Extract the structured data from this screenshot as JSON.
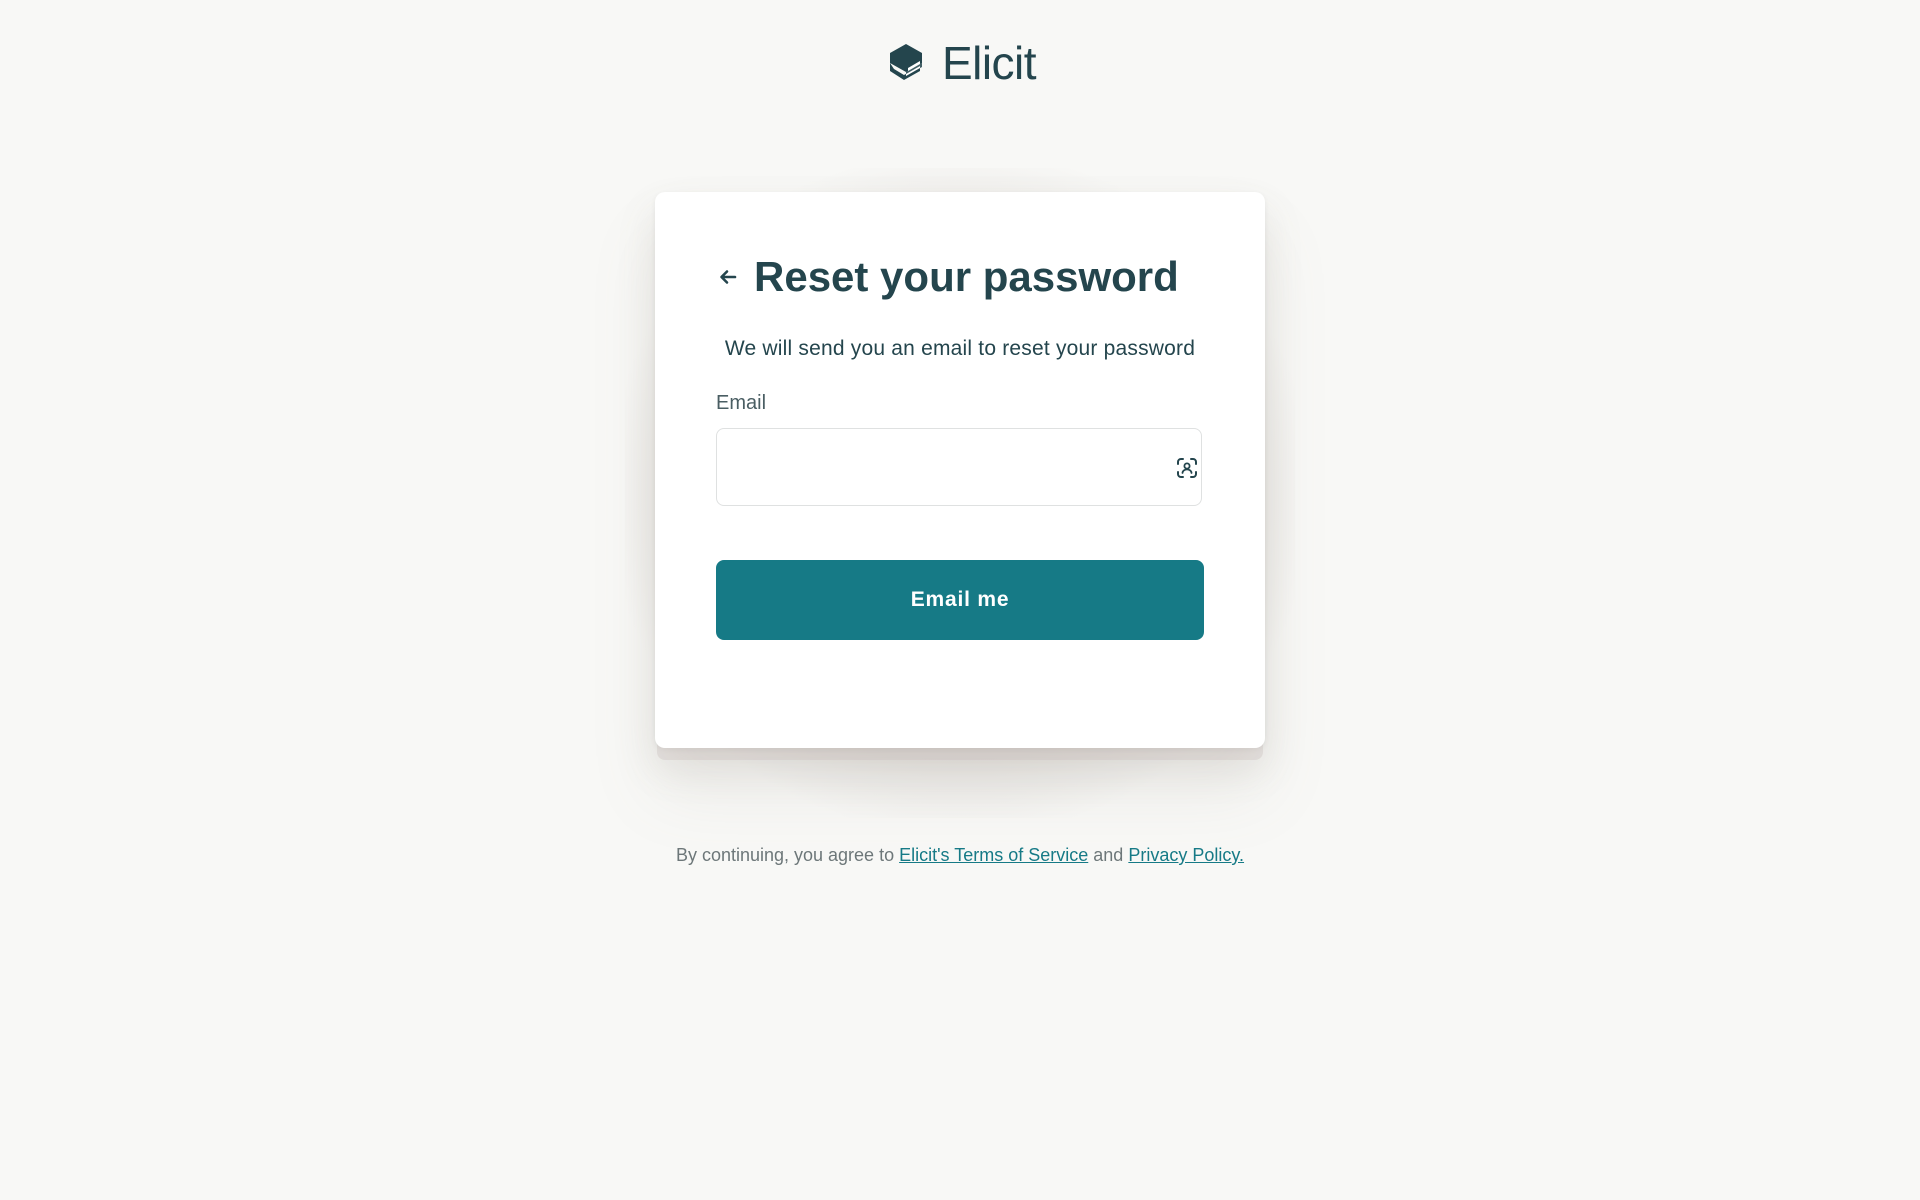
{
  "brand": {
    "name": "Elicit",
    "color": "#24454d"
  },
  "card": {
    "title": "Reset your password",
    "subtitle": "We will send you an email to reset your password",
    "email_label": "Email",
    "email_value": "",
    "email_placeholder": "",
    "submit_label": "Email me",
    "back_icon": "arrow-left-icon",
    "autofill_icon": "face-scan-icon"
  },
  "footer": {
    "prefix": "By continuing, you agree to",
    "terms_link": "Elicit's Terms of Service",
    "conjunction": "and",
    "privacy_link": "Privacy Policy."
  },
  "colors": {
    "background": "#f8f8f6",
    "primary": "#167a86",
    "text_dark": "#24454d",
    "text_muted": "#6d7779"
  }
}
